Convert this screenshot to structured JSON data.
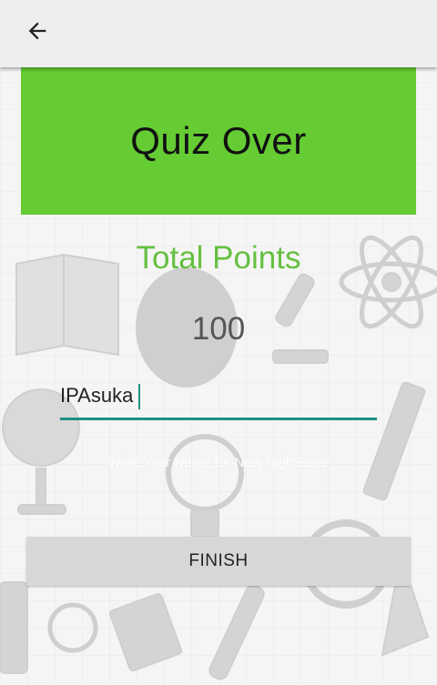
{
  "app_bar": {
    "back_icon": "arrow-left-icon"
  },
  "banner": {
    "title": "Quiz Over",
    "color": "#65cc33"
  },
  "results": {
    "label": "Total Points",
    "score": "100",
    "label_color": "#65c040"
  },
  "name_input": {
    "value": "IPAsuka",
    "underline_color": "#1f8f84"
  },
  "hint": {
    "text": "Write Your Name for New HighScore"
  },
  "finish_button": {
    "label": "FINISH"
  }
}
